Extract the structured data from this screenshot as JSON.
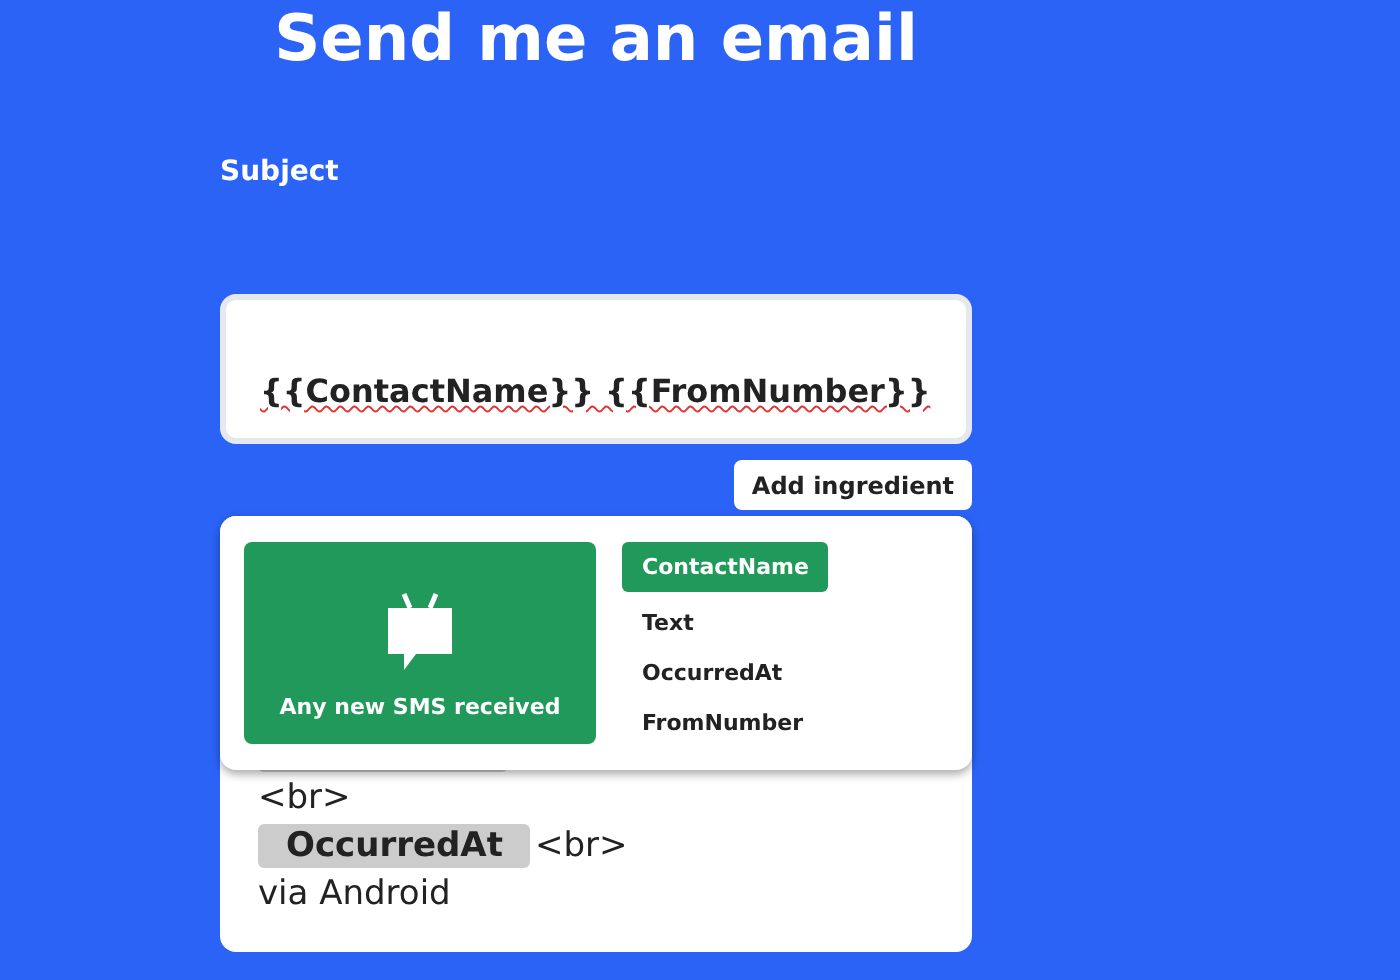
{
  "title": "Send me an email",
  "subject": {
    "label": "Subject",
    "value": "{{ContactName}} {{FromNumber}}"
  },
  "add_ingredient": "Add ingredient",
  "ingredient_menu": {
    "trigger": "Any new SMS received",
    "ingredients": [
      {
        "label": "ContactName",
        "selected": true
      },
      {
        "label": "Text",
        "selected": false
      },
      {
        "label": "OccurredAt",
        "selected": false
      },
      {
        "label": "FromNumber",
        "selected": false
      }
    ]
  },
  "body": {
    "lines": [
      [
        {
          "kind": "chip"
        }
      ],
      [
        {
          "kind": "text",
          "text": "<br>"
        }
      ],
      [
        {
          "kind": "chip",
          "text": "OccurredAt"
        },
        {
          "kind": "text",
          "text": "<br>"
        }
      ],
      [
        {
          "kind": "text",
          "text": "via Android"
        }
      ]
    ]
  }
}
